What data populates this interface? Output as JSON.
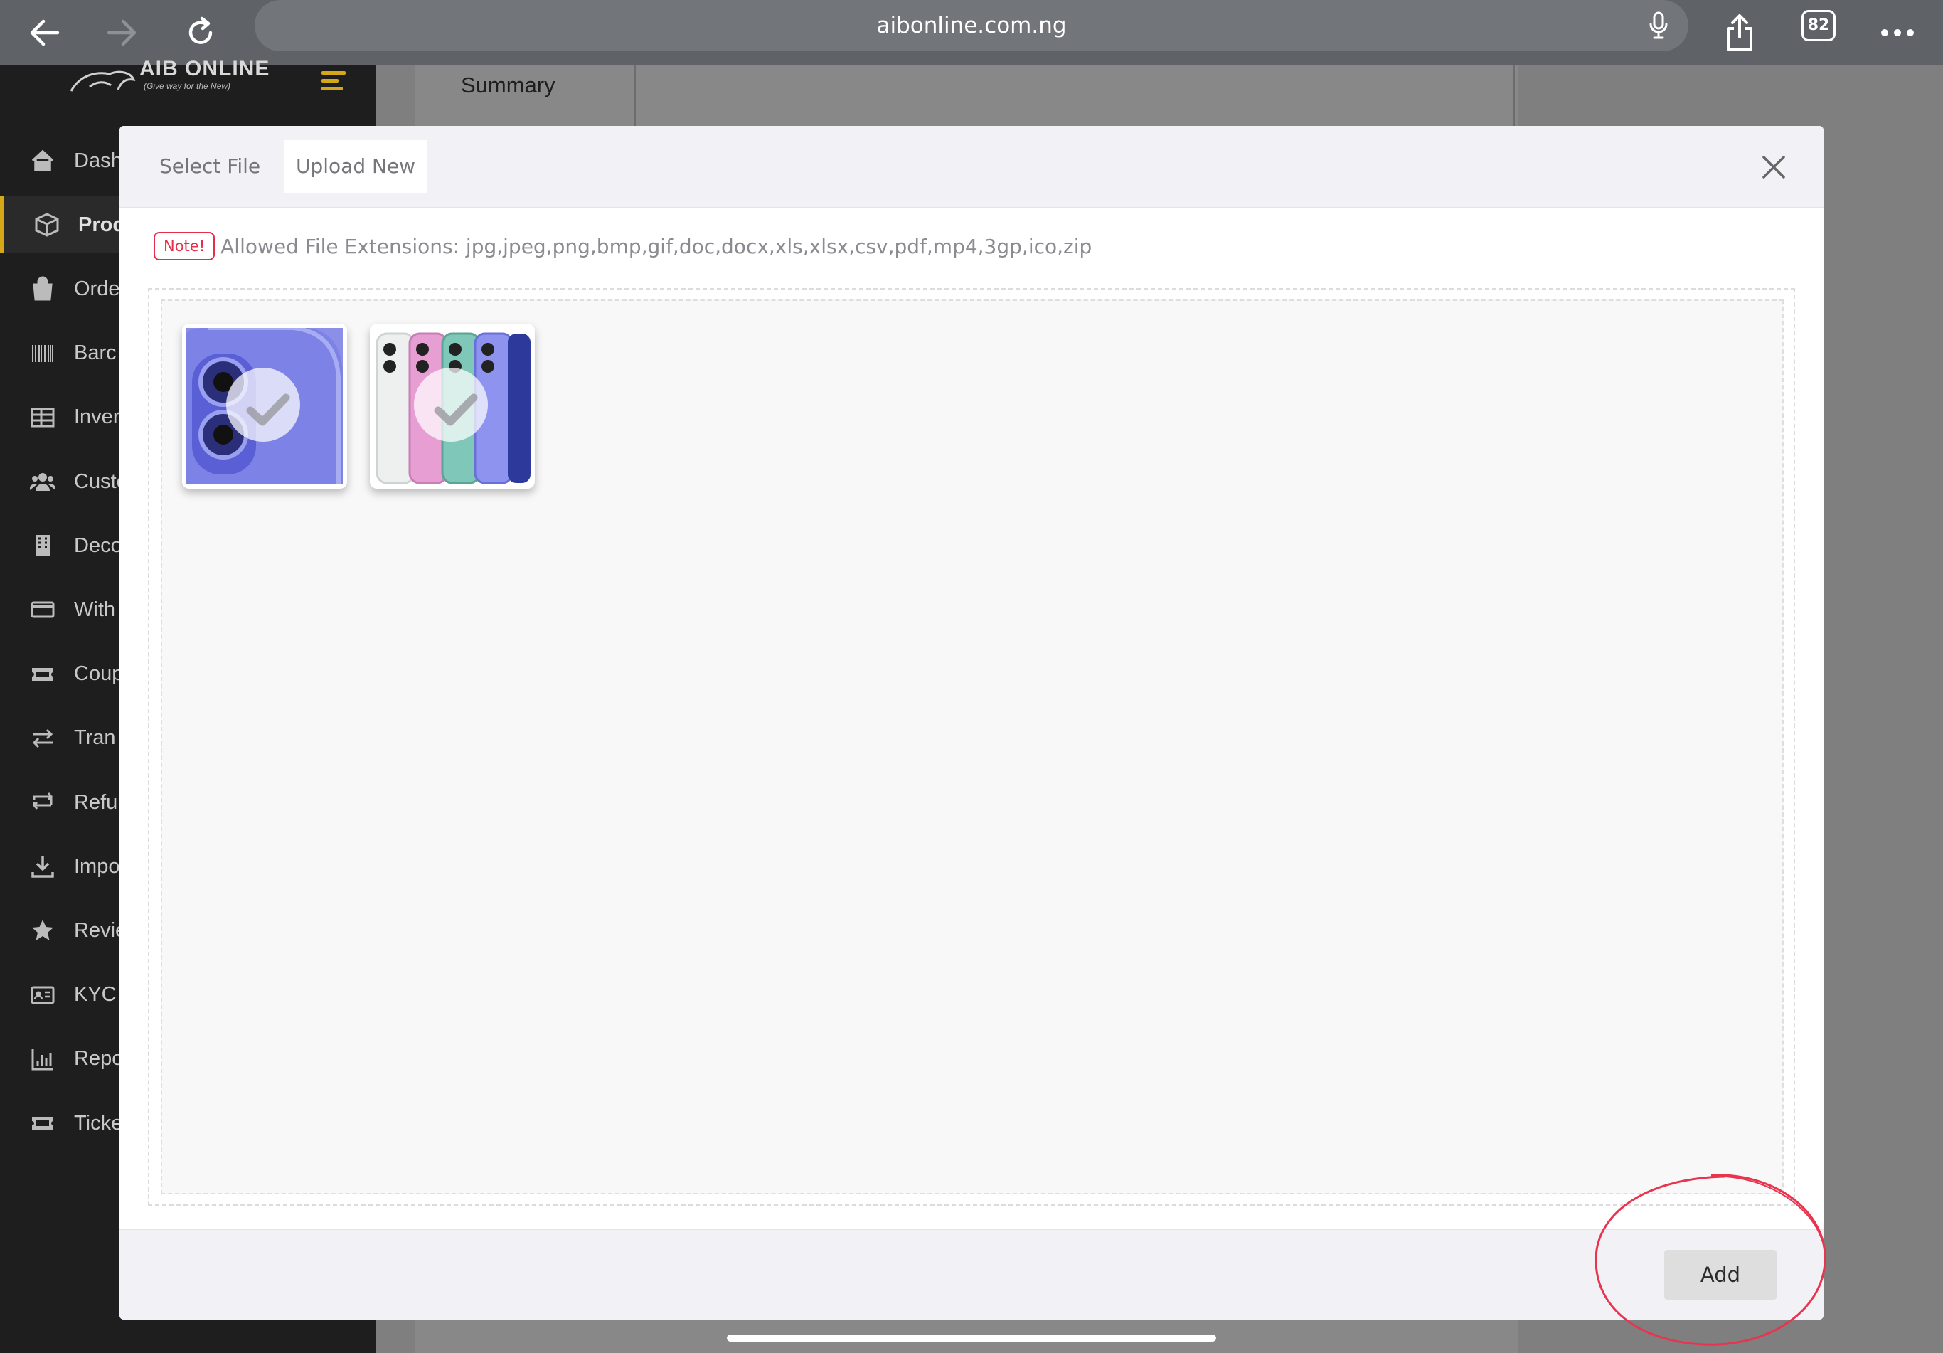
{
  "browser": {
    "url": "aibonline.com.ng",
    "tab_count": "82",
    "icons": [
      "back-arrow-icon",
      "forward-arrow-icon",
      "reload-icon",
      "microphone-icon",
      "share-icon",
      "tabs-icon",
      "more-icon"
    ]
  },
  "sidebar": {
    "logo_text": "AIB ONLINE",
    "logo_tagline": "(Give way for the New)",
    "accent_color": "#d4a817",
    "items": [
      {
        "label": "Dash",
        "icon": "home-icon"
      },
      {
        "label": "Prod",
        "icon": "box-icon",
        "active": true
      },
      {
        "label": "Orde",
        "icon": "shopping-bag-icon"
      },
      {
        "label": "Barc",
        "icon": "barcode-icon"
      },
      {
        "label": "Inver",
        "icon": "table-icon"
      },
      {
        "label": "Custo",
        "icon": "users-icon"
      },
      {
        "label": "Deco",
        "icon": "building-icon"
      },
      {
        "label": "With",
        "icon": "credit-card-icon"
      },
      {
        "label": "Coup",
        "icon": "ticket-icon"
      },
      {
        "label": "Tran",
        "icon": "exchange-icon"
      },
      {
        "label": "Refu",
        "icon": "refund-icon"
      },
      {
        "label": "Impo",
        "icon": "download-icon"
      },
      {
        "label": "Revie",
        "icon": "star-icon"
      },
      {
        "label": "KYC",
        "icon": "id-card-icon"
      },
      {
        "label": "Repo",
        "icon": "bar-chart-icon"
      },
      {
        "label": "Ticke",
        "icon": "ticket-icon"
      }
    ]
  },
  "background": {
    "summary_label": "Summary"
  },
  "modal": {
    "tabs": [
      {
        "label": "Select File",
        "active": false
      },
      {
        "label": "Upload New",
        "active": true
      }
    ],
    "note_badge": "Note!",
    "note_text": "Allowed File Extensions: jpg,jpeg,png,bmp,gif,doc,docx,xls,xlsx,csv,pdf,mp4,3gp,ico,zip",
    "files": [
      {
        "name": "phone-camera-closeup",
        "selected": true
      },
      {
        "name": "phones-color-lineup",
        "selected": true
      }
    ],
    "add_button": "Add",
    "note_color": "#e2304a",
    "annotation_color": "#e8344f"
  }
}
